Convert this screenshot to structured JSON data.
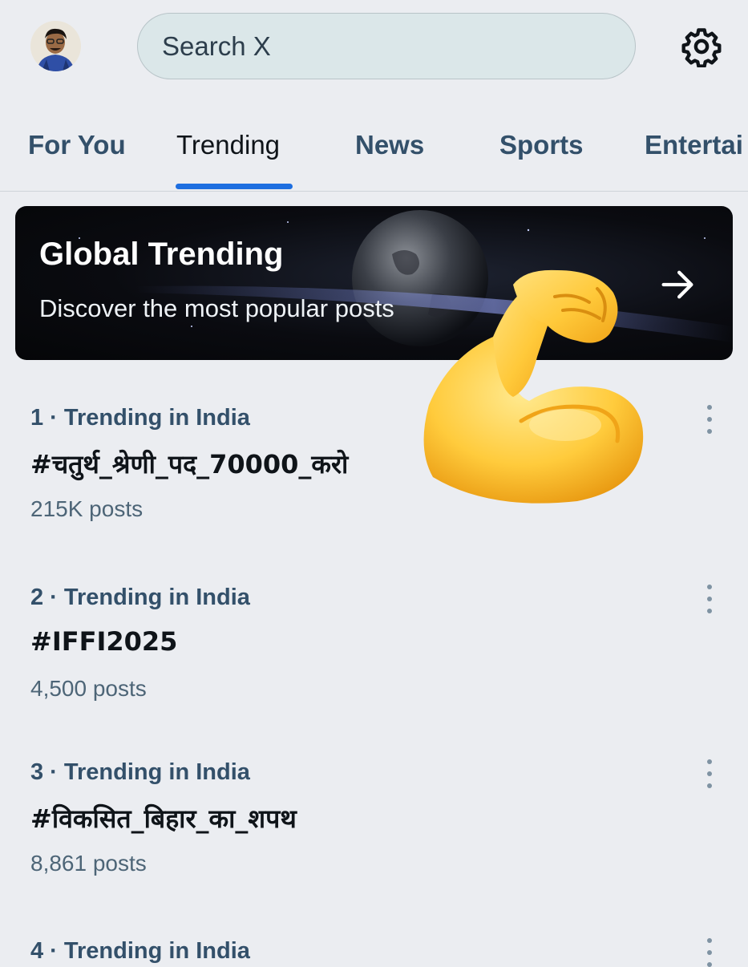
{
  "header": {
    "search_placeholder": "Search X",
    "avatar_icon": "user-avatar",
    "settings_icon": "gear-icon"
  },
  "tabs": [
    {
      "label": "For You",
      "active": false
    },
    {
      "label": "Trending",
      "active": true
    },
    {
      "label": "News",
      "active": false
    },
    {
      "label": "Sports",
      "active": false
    },
    {
      "label": "Entertai",
      "active": false
    }
  ],
  "banner": {
    "title": "Global Trending",
    "subtitle": "Discover the most popular posts",
    "arrow_icon": "arrow-right-icon"
  },
  "trends": [
    {
      "meta": "1 · Trending in India",
      "name": "#चतुर्थ_श्रेणी_पद_70000_करो",
      "count": "215K posts"
    },
    {
      "meta": "2 · Trending in India",
      "name": "#IFFI2025",
      "count": "4,500 posts"
    },
    {
      "meta": "3 · Trending in India",
      "name": "#विकसित_बिहार_का_शपथ",
      "count": "8,861 posts"
    },
    {
      "meta": "4 · Trending in India",
      "name": "",
      "count": ""
    }
  ],
  "overlay": {
    "emoji_icon": "flexed-biceps-icon"
  },
  "colors": {
    "accent": "#1d6ee0",
    "background": "#ebedf1",
    "secondary_text": "#33506a"
  }
}
